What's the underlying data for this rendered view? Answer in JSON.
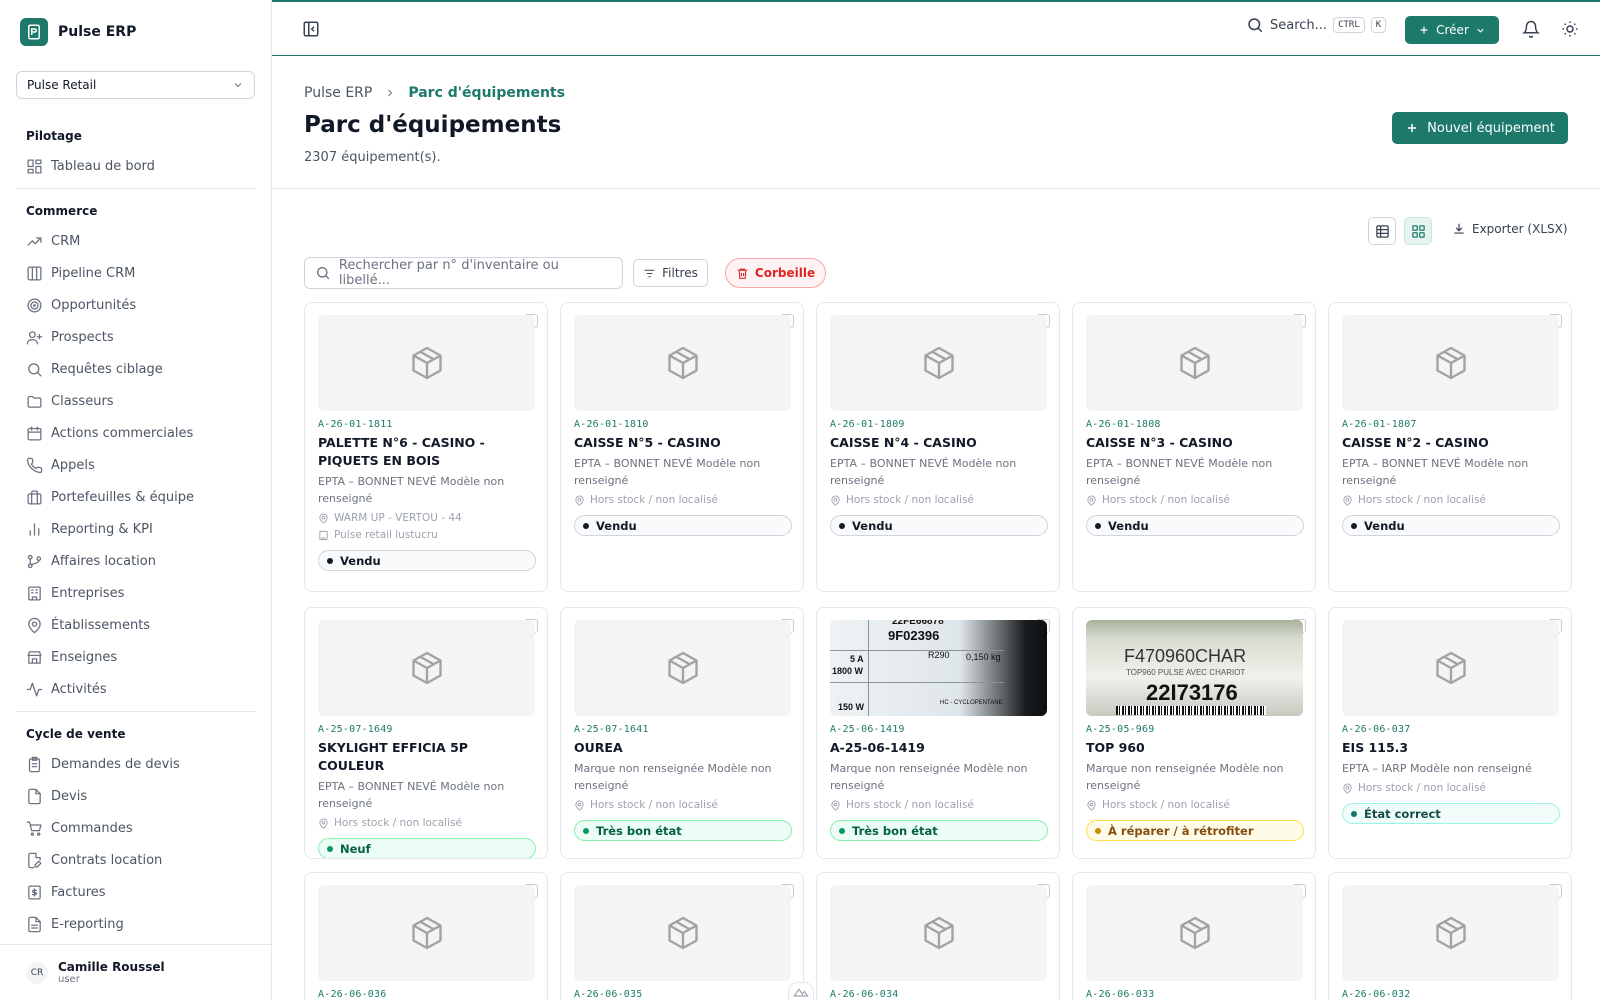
{
  "app": {
    "name": "Pulse ERP"
  },
  "org_select": {
    "value": "Pulse Retail"
  },
  "nav": {
    "sections": [
      {
        "title": "Pilotage",
        "items": [
          {
            "label": "Tableau de bord",
            "icon": "dashboard-icon"
          }
        ]
      },
      {
        "title": "Commerce",
        "items": [
          {
            "label": "CRM",
            "icon": "trend-icon"
          },
          {
            "label": "Pipeline CRM",
            "icon": "columns-icon"
          },
          {
            "label": "Opportunités",
            "icon": "target-icon"
          },
          {
            "label": "Prospects",
            "icon": "user-plus-icon"
          },
          {
            "label": "Requêtes ciblage",
            "icon": "search-icon"
          },
          {
            "label": "Classeurs",
            "icon": "folder-icon"
          },
          {
            "label": "Actions commerciales",
            "icon": "calendar-icon"
          },
          {
            "label": "Appels",
            "icon": "phone-icon"
          },
          {
            "label": "Portefeuilles & équipe",
            "icon": "briefcase-icon"
          },
          {
            "label": "Reporting & KPI",
            "icon": "bar-chart-icon"
          },
          {
            "label": "Affaires location",
            "icon": "branch-icon"
          },
          {
            "label": "Entreprises",
            "icon": "building-icon"
          },
          {
            "label": "Établissements",
            "icon": "map-pin-icon"
          },
          {
            "label": "Enseignes",
            "icon": "store-icon"
          },
          {
            "label": "Activités",
            "icon": "activity-icon"
          }
        ]
      },
      {
        "title": "Cycle de vente",
        "items": [
          {
            "label": "Demandes de devis",
            "icon": "clipboard-icon"
          },
          {
            "label": "Devis",
            "icon": "file-icon"
          },
          {
            "label": "Commandes",
            "icon": "cart-icon"
          },
          {
            "label": "Contrats location",
            "icon": "file-edit-icon"
          },
          {
            "label": "Factures",
            "icon": "invoice-icon"
          },
          {
            "label": "E-reporting",
            "icon": "file-text-icon"
          }
        ]
      }
    ]
  },
  "user": {
    "initials": "CR",
    "name": "Camille Roussel",
    "role": "user"
  },
  "header": {
    "search_label": "Search...",
    "kbd1": "CTRL",
    "kbd2": "K",
    "create_label": "Créer"
  },
  "breadcrumb": {
    "root": "Pulse ERP",
    "current": "Parc d'équipements"
  },
  "page": {
    "title": "Parc d'équipements",
    "count": "2307 équipement(s).",
    "new_button": "Nouvel équipement"
  },
  "toolbar": {
    "export_label": "Exporter (XLSX)",
    "search_placeholder": "Rechercher par n° d'inventaire ou libellé...",
    "filters_label": "Filtres",
    "trash_label": "Corbeille"
  },
  "status_colors": {
    "accent": "#1d7a6b",
    "danger": "#dc2626"
  },
  "cards": [
    {
      "inv": "A-26-01-1811",
      "title": "PALETTE N°6 - CASINO - PIQUETS EN BOIS",
      "desc": "EPTA – BONNET NEVÉ Modèle non renseigné",
      "location": "WARM UP - VERTOU - 44",
      "client": "Pulse retail lustucru",
      "status": "Vendu",
      "status_style": "gray",
      "image": "placeholder"
    },
    {
      "inv": "A-26-01-1810",
      "title": "CAISSE N°5 - CASINO",
      "desc": "EPTA – BONNET NEVÉ Modèle non renseigné",
      "location": "Hors stock / non localisé",
      "client": "",
      "status": "Vendu",
      "status_style": "gray",
      "image": "placeholder"
    },
    {
      "inv": "A-26-01-1809",
      "title": "CAISSE N°4 - CASINO",
      "desc": "EPTA – BONNET NEVÉ Modèle non renseigné",
      "location": "Hors stock / non localisé",
      "client": "",
      "status": "Vendu",
      "status_style": "gray",
      "image": "placeholder"
    },
    {
      "inv": "A-26-01-1808",
      "title": "CAISSE N°3 - CASINO",
      "desc": "EPTA – BONNET NEVÉ Modèle non renseigné",
      "location": "Hors stock / non localisé",
      "client": "",
      "status": "Vendu",
      "status_style": "gray",
      "image": "placeholder"
    },
    {
      "inv": "A-26-01-1807",
      "title": "CAISSE N°2 - CASINO",
      "desc": "EPTA – BONNET NEVÉ Modèle non renseigné",
      "location": "Hors stock / non localisé",
      "client": "",
      "status": "Vendu",
      "status_style": "gray",
      "image": "placeholder"
    },
    {
      "inv": "A-25-07-1649",
      "title": "SKYLIGHT EFFICIA 5P COULEUR",
      "desc": "EPTA – BONNET NEVÉ Modèle non renseigné",
      "location": "Hors stock / non localisé",
      "client": "",
      "status": "Neuf",
      "status_style": "green",
      "image": "placeholder"
    },
    {
      "inv": "A-25-07-1641",
      "title": "OUREA",
      "desc": "Marque non renseignée Modèle non renseigné",
      "location": "Hors stock / non localisé",
      "client": "",
      "status": "Très bon état",
      "status_style": "green",
      "image": "placeholder"
    },
    {
      "inv": "A-25-06-1419",
      "title": "A-25-06-1419",
      "desc": "Marque non renseignée Modèle non renseigné",
      "location": "Hors stock / non localisé",
      "client": "",
      "status": "Très bon état",
      "status_style": "green",
      "image": "photo-label",
      "photo_text": [
        "22FE66878",
        "9F02396",
        "R290",
        "0,150 kg",
        "5 A",
        "1800 W",
        "150 W",
        "HC - CYCLOPENTANE"
      ]
    },
    {
      "inv": "A-25-05-969",
      "title": "TOP 960",
      "desc": "Marque non renseignée Modèle non renseigné",
      "location": "Hors stock / non localisé",
      "client": "",
      "status": "À réparer / à rétrofiter",
      "status_style": "yellow",
      "image": "photo-tag",
      "photo_text": [
        "F470960CHAR",
        "TOP960 PULSE AVEC CHARIOT",
        "22I73176"
      ]
    },
    {
      "inv": "A-26-06-037",
      "title": "EIS 115.3",
      "desc": "EPTA – IARP Modèle non renseigné",
      "location": "Hors stock / non localisé",
      "client": "",
      "status": "État correct",
      "status_style": "teal",
      "image": "placeholder"
    },
    {
      "inv": "A-26-06-036",
      "title": "",
      "desc": "",
      "location": "",
      "client": "",
      "status": "",
      "status_style": "",
      "image": "placeholder"
    },
    {
      "inv": "A-26-06-035",
      "title": "",
      "desc": "",
      "location": "",
      "client": "",
      "status": "",
      "status_style": "",
      "image": "placeholder"
    },
    {
      "inv": "A-26-06-034",
      "title": "",
      "desc": "",
      "location": "",
      "client": "",
      "status": "",
      "status_style": "",
      "image": "placeholder"
    },
    {
      "inv": "A-26-06-033",
      "title": "",
      "desc": "",
      "location": "",
      "client": "",
      "status": "",
      "status_style": "",
      "image": "placeholder"
    },
    {
      "inv": "A-26-06-032",
      "title": "",
      "desc": "",
      "location": "",
      "client": "",
      "status": "",
      "status_style": "",
      "image": "placeholder"
    }
  ]
}
